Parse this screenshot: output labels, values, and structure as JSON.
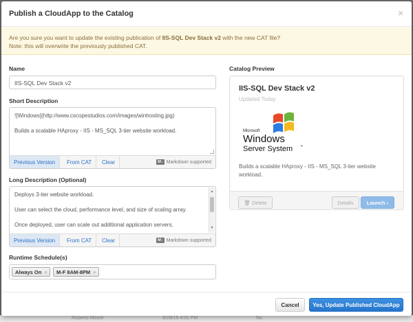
{
  "modal": {
    "title": "Publish a CloudApp to the Catalog",
    "close_glyph": "×"
  },
  "warning": {
    "line1_prefix": "Are you sure you want to update the existing publication of ",
    "line1_name": "IIS-SQL Dev Stack v2",
    "line1_suffix": " with the new CAT file?",
    "line2": "Note: this will overwrite the previously published CAT."
  },
  "form": {
    "name_label": "Name",
    "name_value": "IIS-SQL Dev Stack v2",
    "short_desc_label": "Short Description",
    "short_desc_lines": [
      "![Windows](http://www.cscopestudios.com/images/winhosting.jpg)",
      "Builds a scalable HAproxy - IIS - MS_SQL 3-tier website workload."
    ],
    "long_desc_label": "Long Description (Optional)",
    "long_desc_lines": [
      "Deploys 3-tier website workload.",
      "User can select the cloud, performance level, and size of scaling array.",
      "Once deployed, user can scale out additional application servers."
    ],
    "md_buttons": {
      "previous": "Previous Version",
      "from_cat": "From CAT",
      "clear": "Clear"
    },
    "md_badge": "M↓",
    "md_note": "Markdown supported",
    "schedule_label": "Runtime Schedule(s)",
    "schedules": [
      "Always On",
      "M-F 8AM-8PM"
    ],
    "tag_remove_glyph": "×"
  },
  "preview": {
    "label": "Catalog Preview",
    "title": "IIS-SQL Dev Stack v2",
    "updated": "Updated Today",
    "logo": {
      "microsoft": "Microsoft",
      "line1": "Windows",
      "line2": "Server System",
      "reg": "®"
    },
    "description": "Builds a scalable HAproxy - IIS - MS_SQL 3-tier website workload.",
    "delete_label": "Delete",
    "details_label": "Details",
    "launch_label": "Launch ›"
  },
  "footer": {
    "cancel_label": "Cancel",
    "confirm_label": "Yes, Update Published CloudApp"
  },
  "background_row": {
    "col1": "Roberto Moore",
    "col2": "8/29/15 4:01 PM",
    "col3": "No"
  },
  "colors": {
    "primary": "#2676cc",
    "warning_bg": "#fcf8e3",
    "warning_text": "#8a6d3b",
    "link": "#2a6fc9"
  }
}
